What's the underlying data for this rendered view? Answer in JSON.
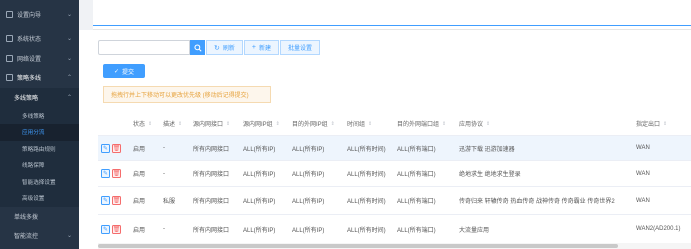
{
  "sidebar": {
    "top_items": [
      {
        "label": "设置向导",
        "icon": "gear-icon"
      },
      {
        "label": "系统状态",
        "icon": "monitor-icon"
      },
      {
        "label": "网络设置",
        "icon": "network-icon"
      },
      {
        "label": "策略多线",
        "icon": "routing-icon"
      }
    ],
    "submenu_title": "多线策略",
    "submenu_items": [
      "多线策略",
      "应用分流",
      "策略路由规则",
      "线路保障",
      "智能选择设置",
      "高级设置"
    ],
    "active_item": "应用分流",
    "lower_items": [
      "单线多拨",
      "智能流控"
    ]
  },
  "toolbar": {
    "search_placeholder": "",
    "refresh_label": "刷新",
    "new_label": "新建",
    "batch_label": "批量设置"
  },
  "submit_label": "提交",
  "tip_text": "拖拽行并上下移动可以更改优先级 (移动后记得提交)",
  "table": {
    "columns": [
      "状态",
      "描述",
      "源内网接口",
      "源内网IP组",
      "目的外网IP组",
      "时间组",
      "目的外网端口组",
      "应用协议",
      "指定出口"
    ],
    "rows": [
      {
        "status": "启用",
        "desc": "-",
        "src_if": "所有内网接口",
        "src_ip": "ALL(所有IP)",
        "dst_ip": "ALL(所有IP)",
        "time": "ALL(所有时间)",
        "dst_port": "ALL(所有端口)",
        "app": "迅游下载 迅游加速器",
        "out": "WAN"
      },
      {
        "status": "启用",
        "desc": "-",
        "src_if": "所有内网接口",
        "src_ip": "ALL(所有IP)",
        "dst_ip": "ALL(所有IP)",
        "time": "ALL(所有时间)",
        "dst_port": "ALL(所有端口)",
        "app": "绝地求生 绝地求生登录",
        "out": "WAN"
      },
      {
        "status": "启用",
        "desc": "私服",
        "src_if": "所有内网接口",
        "src_ip": "ALL(所有IP)",
        "dst_ip": "ALL(所有IP)",
        "time": "ALL(所有时间)",
        "dst_port": "ALL(所有端口)",
        "app": "传奇归来 轩辕传奇 热血传奇 战神传奇 传奇霸业 传奇世界2",
        "out": "WAN"
      },
      {
        "status": "启用",
        "desc": "-",
        "src_if": "所有内网接口",
        "src_ip": "ALL(所有IP)",
        "dst_ip": "ALL(所有IP)",
        "time": "ALL(所有时间)",
        "dst_port": "ALL(所有端口)",
        "app": "大流量应用",
        "out": "WAN2(AD200.1)"
      }
    ]
  }
}
